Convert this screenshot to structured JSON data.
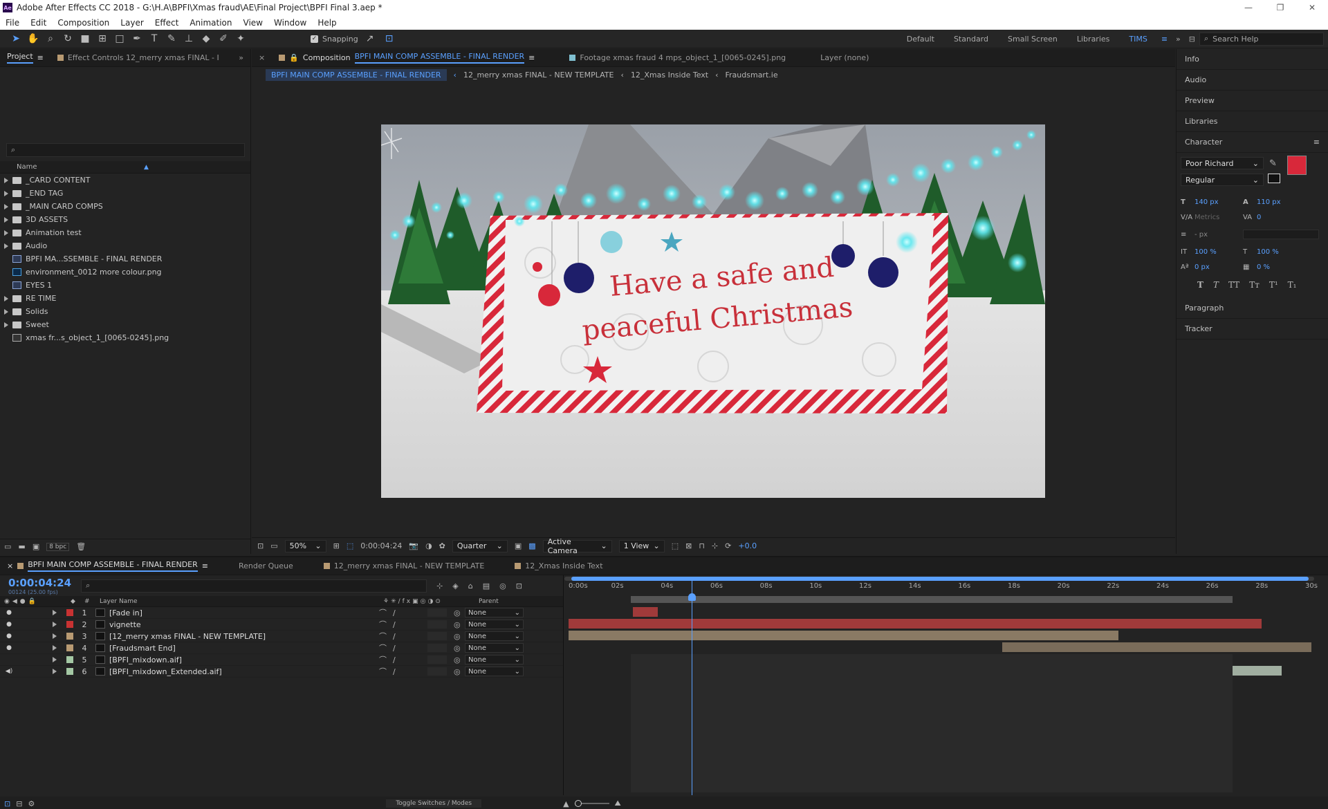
{
  "window": {
    "app_badge": "Ae",
    "title": "Adobe After Effects CC 2018 - G:\\H.A\\BPFI\\Xmas fraud\\AE\\Final Project\\BPFI Final 3.aep *",
    "controls": [
      "—",
      "❐",
      "✕"
    ]
  },
  "menu": [
    "File",
    "Edit",
    "Composition",
    "Layer",
    "Effect",
    "Animation",
    "View",
    "Window",
    "Help"
  ],
  "toolbar": {
    "snapping_label": "Snapping",
    "workspaces": [
      "Default",
      "Standard",
      "Small Screen",
      "Libraries",
      "TIMS"
    ],
    "active_workspace": "TIMS",
    "search_placeholder": "Search Help"
  },
  "project_panel": {
    "tab_label": "Project",
    "effect_controls_label": "Effect Controls 12_merry xmas FINAL - I",
    "name_header": "Name",
    "items": [
      {
        "label": "_CARD CONTENT",
        "type": "folder"
      },
      {
        "label": "_END TAG",
        "type": "folder"
      },
      {
        "label": "_MAIN CARD COMPS",
        "type": "folder"
      },
      {
        "label": "3D ASSETS",
        "type": "folder"
      },
      {
        "label": "Animation test",
        "type": "folder"
      },
      {
        "label": "Audio",
        "type": "folder"
      },
      {
        "label": "BPFI MA...SSEMBLE - FINAL RENDER",
        "type": "comp"
      },
      {
        "label": "environment_0012 more colour.png",
        "type": "psd"
      },
      {
        "label": "EYES 1",
        "type": "comp"
      },
      {
        "label": "RE TIME",
        "type": "folder"
      },
      {
        "label": "Solids",
        "type": "folder"
      },
      {
        "label": "Sweet",
        "type": "folder"
      },
      {
        "label": "xmas fr...s_object_1_[0065-0245].png",
        "type": "footage"
      }
    ],
    "bpc_label": "8 bpc"
  },
  "comp_panel": {
    "tab_prefix": "Composition",
    "tab_comp_name": "BPFI MAIN COMP ASSEMBLE - FINAL RENDER",
    "footage_tab": "Footage  xmas fraud 4 mps_object_1_[0065-0245].png",
    "layer_tab": "Layer  (none)",
    "breadcrumbs": [
      "BPFI MAIN COMP ASSEMBLE - FINAL RENDER",
      "12_merry xmas FINAL - NEW TEMPLATE",
      "12_Xmas Inside Text",
      "Fraudsmart.ie"
    ],
    "card_text_line1": "Have a safe and",
    "card_text_line2": "peaceful Christmas",
    "magnification": "50%",
    "timecode": "0:00:04:24",
    "resolution": "Quarter",
    "camera": "Active Camera",
    "view_count": "1 View",
    "exposure": "+0.0"
  },
  "right_panel": {
    "sections_top": [
      "Info",
      "Audio",
      "Preview",
      "Libraries"
    ],
    "character": {
      "title": "Character",
      "font_family": "Poor Richard",
      "font_style": "Regular",
      "fill_color": "#d8283a",
      "font_size": "140 px",
      "leading": "110 px",
      "kerning": "Metrics",
      "tracking": "0",
      "stroke_width": "- px",
      "vertical_scale": "100 %",
      "horizontal_scale": "100 %",
      "baseline_shift": "0 px",
      "tsume": "0 %",
      "style_buttons": [
        "T",
        "T",
        "TT",
        "Tт",
        "T¹",
        "T₁"
      ]
    },
    "sections_bottom": [
      "Paragraph",
      "Tracker"
    ]
  },
  "timeline": {
    "tabs": [
      {
        "label": "BPFI MAIN COMP ASSEMBLE - FINAL RENDER",
        "active": true,
        "color": "#b89a72"
      },
      {
        "label": "Render Queue",
        "active": false,
        "color": ""
      },
      {
        "label": "12_merry xmas FINAL - NEW TEMPLATE",
        "active": false,
        "color": "#b89a72"
      },
      {
        "label": "12_Xmas Inside Text",
        "active": false,
        "color": "#b89a72"
      }
    ],
    "current_time": "0:00:04:24",
    "frame_info": "00124 (25.00 fps)",
    "column_headers": {
      "num": "#",
      "layer_name": "Layer Name",
      "parent": "Parent"
    },
    "ruler_labels": [
      "0:00s",
      "02s",
      "04s",
      "06s",
      "08s",
      "10s",
      "12s",
      "14s",
      "16s",
      "18s",
      "20s",
      "22s",
      "24s",
      "26s",
      "28s",
      "30s"
    ],
    "layers": [
      {
        "num": "1",
        "name": "[Fade in]",
        "color": "#c83232",
        "parent": "None",
        "eye": "●"
      },
      {
        "num": "2",
        "name": "vignette",
        "color": "#c83232",
        "parent": "None",
        "eye": "●"
      },
      {
        "num": "3",
        "name": "[12_merry xmas FINAL - NEW TEMPLATE]",
        "color": "#b89a72",
        "parent": "None",
        "eye": "●"
      },
      {
        "num": "4",
        "name": "[Fraudsmart End]",
        "color": "#b89a72",
        "parent": "None",
        "eye": "●"
      },
      {
        "num": "5",
        "name": "[BPFI_mixdown.aif]",
        "color": "#a4c8a4",
        "parent": "None",
        "eye": ""
      },
      {
        "num": "6",
        "name": "[BPFI_mixdown_Extended.aif]",
        "color": "#a4c8a4",
        "parent": "None",
        "eye": "◀)"
      }
    ],
    "toggle_label": "Toggle Switches / Modes"
  }
}
